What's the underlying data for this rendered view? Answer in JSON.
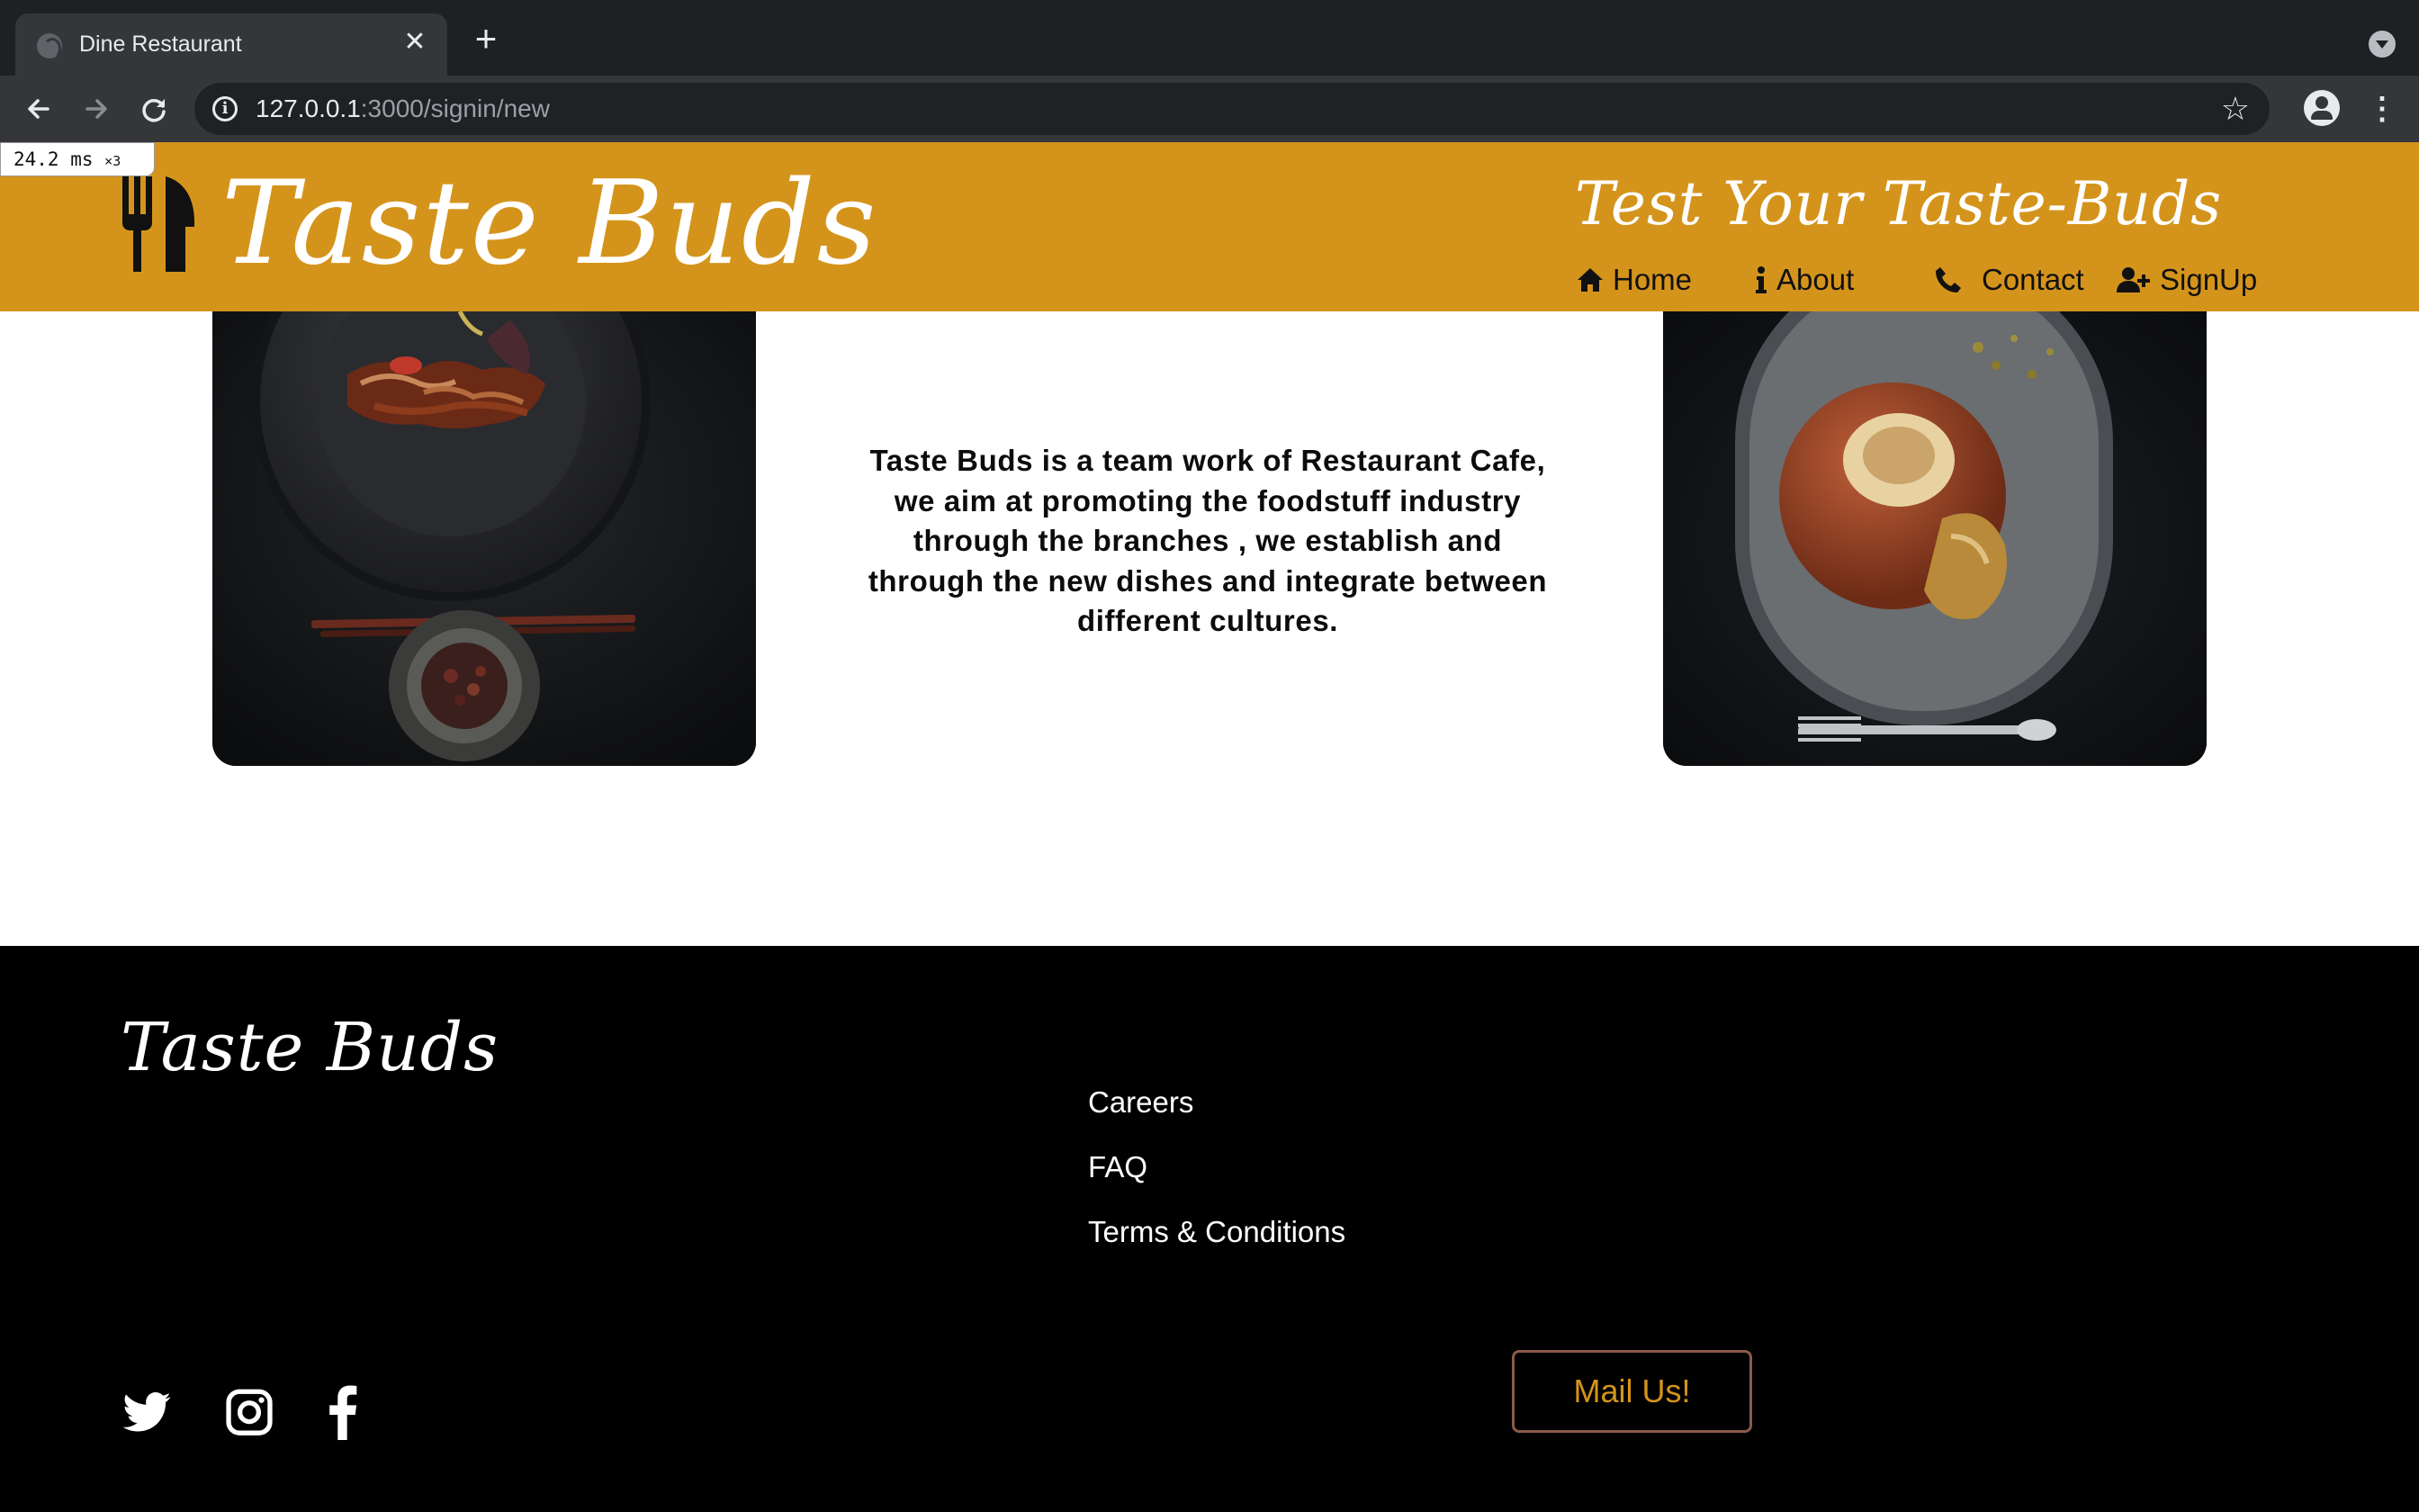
{
  "browser": {
    "tab_title": "Dine Restaurant",
    "url_host": "127.0.0.1",
    "url_rest": ":3000/signin/new",
    "perf_time": "24.2 ms",
    "perf_mult": "×3"
  },
  "header": {
    "logo": "Taste Buds",
    "tagline": "Test Your Taste-Buds",
    "nav": [
      {
        "label": "Home",
        "icon": "home-icon"
      },
      {
        "label": "About",
        "icon": "info-icon"
      },
      {
        "label": "Contact",
        "icon": "phone-icon"
      },
      {
        "label": "SignUp",
        "icon": "user-plus-icon"
      }
    ],
    "background_color": "#d4941c"
  },
  "main": {
    "about_text": "Taste Buds is a team work of Restaurant Cafe, we aim at promoting the foodstuff industry through the branches , we establish and through the new dishes and integrate between different cultures."
  },
  "footer": {
    "logo": "Taste Buds",
    "links": [
      "Careers",
      "FAQ",
      "Terms & Conditions"
    ],
    "social": [
      "twitter-icon",
      "instagram-icon",
      "facebook-icon"
    ],
    "mail_button": "Mail Us!",
    "accent_color": "#d4941c"
  }
}
